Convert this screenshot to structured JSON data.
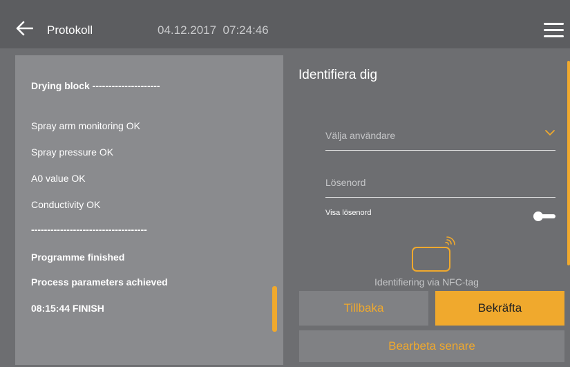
{
  "header": {
    "title": "Protokoll",
    "date": "04.12.2017",
    "time": "07:24:46"
  },
  "protocol": {
    "lines": [
      {
        "text": "Drying block ---------------------",
        "bold": true
      },
      {
        "text": "Spray arm monitoring OK",
        "bold": false
      },
      {
        "text": "Spray pressure OK",
        "bold": false
      },
      {
        "text": "A0 value OK",
        "bold": false
      },
      {
        "text": "Conductivity OK",
        "bold": false
      },
      {
        "text": "------------------------------------",
        "bold": true
      },
      {
        "text": "Programme finished",
        "bold": true
      },
      {
        "text": "Process parameters achieved",
        "bold": true
      },
      {
        "text": "08:15:44 FINISH",
        "bold": true
      }
    ]
  },
  "login": {
    "title": "Identifiera dig",
    "user_placeholder": "Välja användare",
    "password_placeholder": "Lösenord",
    "show_password_label": "Visa lösenord",
    "nfc_label": "Identifiering via NFC-tag"
  },
  "buttons": {
    "back": "Tillbaka",
    "confirm": "Bekräfta",
    "later": "Bearbeta senare"
  },
  "colors": {
    "accent": "#f0a92d",
    "header_bg": "#5c5d60",
    "panel_bg": "#8a8b8e"
  },
  "icons": {
    "back": "arrow-left-icon",
    "menu": "hamburger-menu-icon",
    "dropdown": "chevron-down-icon",
    "nfc": "nfc-card-icon"
  }
}
